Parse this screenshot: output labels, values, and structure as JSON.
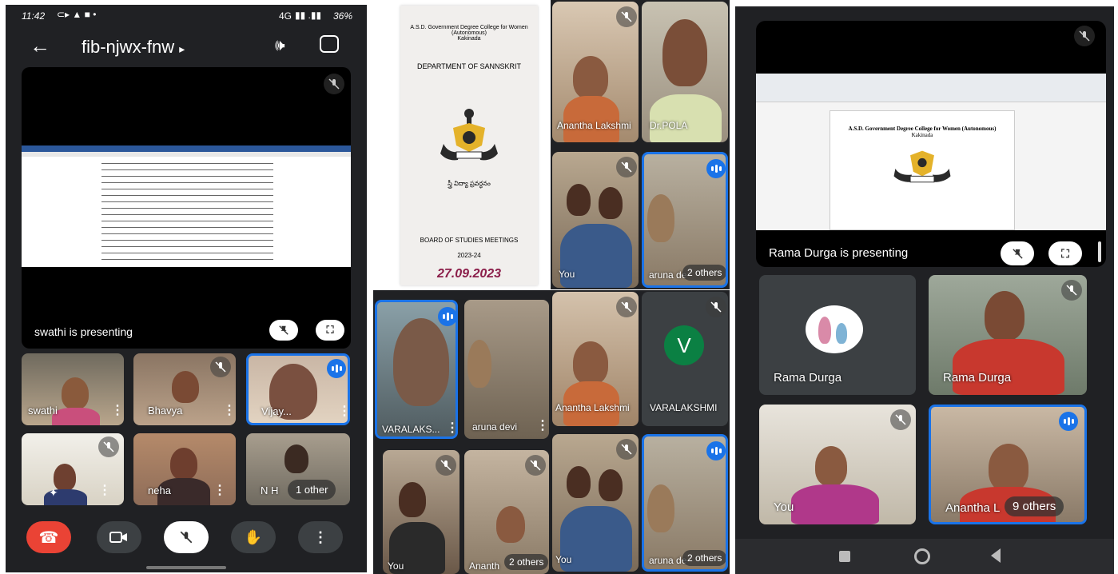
{
  "status_bar": {
    "time": "11:42",
    "network": "4G",
    "battery": "36%"
  },
  "meet": {
    "code": "fib-njwx-fnw",
    "code_arrow": "▸",
    "presenting": "swathi is presenting",
    "controls": [
      "end-call",
      "camera",
      "mic",
      "raise-hand",
      "more"
    ]
  },
  "left_tiles": [
    {
      "name": "swathi"
    },
    {
      "name": "Bhavya"
    },
    {
      "name": "Vijay..."
    },
    {
      "name": ""
    },
    {
      "name": "neha"
    },
    {
      "name": "N H"
    }
  ],
  "left_others": "1 other",
  "doc_panel": {
    "college": "A.S.D. Government Degree College for Women (Autonomous)",
    "city": "Kakinada",
    "department": "DEPARTMENT OF SANNSKRIT",
    "motto": "స్త్రీ విద్యా ప్రవర్ధనం",
    "meeting": "BOARD OF STUDIES MEETINGS",
    "year": "2023-24",
    "date": "27.09.2023"
  },
  "mid_tiles": {
    "top_right": [
      {
        "name": "Anantha Lakshmi"
      },
      {
        "name": "Dr.POLA"
      },
      {
        "name": "You"
      },
      {
        "name": "aruna de"
      }
    ],
    "top_right_others": "2 others",
    "bottom_left": [
      {
        "name": "VARALAKS..."
      },
      {
        "name": "aruna devi"
      },
      {
        "name": "You"
      },
      {
        "name": "Ananth"
      }
    ],
    "bottom_left_others": "2 others",
    "bottom_right": [
      {
        "name": "Anantha Lakshmi"
      },
      {
        "name": "VARALAKSHMI",
        "initial": "V"
      },
      {
        "name": "You"
      },
      {
        "name": "aruna de"
      }
    ],
    "bottom_right_others": "2 others"
  },
  "right_panel": {
    "presenting": "Rama Durga is presenting",
    "doc_title": "A.S.D. Government Degree College for Women (Autonomous)",
    "doc_city": "Kakinada",
    "tiles": [
      {
        "name": "Rama Durga"
      },
      {
        "name": "Rama Durga"
      },
      {
        "name": "You"
      },
      {
        "name": "Anantha L"
      }
    ],
    "others": "9 others"
  },
  "colors": {
    "bg_dark": "#202124",
    "tile": "#3c4043",
    "accent_blue": "#1a73e8",
    "end_call": "#ea4335",
    "avatar_green": "#0b8043"
  }
}
